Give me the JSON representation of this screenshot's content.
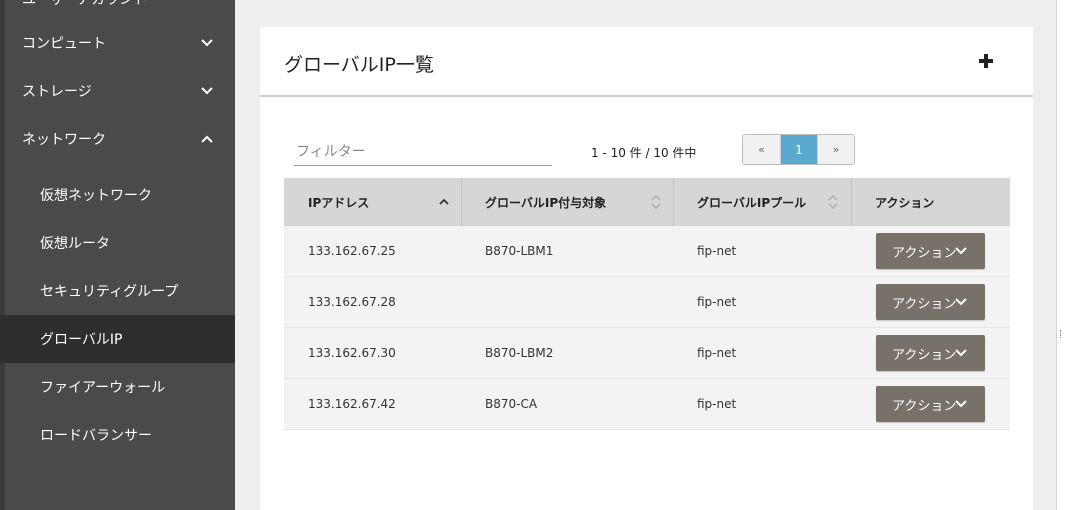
{
  "sidebar": {
    "top_partial": "ユーザーアカウント",
    "sections": [
      {
        "label": "コンピュート",
        "expanded": false
      },
      {
        "label": "ストレージ",
        "expanded": false
      },
      {
        "label": "ネットワーク",
        "expanded": true
      }
    ],
    "sub_items": [
      {
        "label": "仮想ネットワーク",
        "active": false
      },
      {
        "label": "仮想ルータ",
        "active": false
      },
      {
        "label": "セキュリティグループ",
        "active": false
      },
      {
        "label": "グローバルIP",
        "active": true
      },
      {
        "label": "ファイアーウォール",
        "active": false
      },
      {
        "label": "ロードバランサー",
        "active": false
      }
    ]
  },
  "main": {
    "title": "グローバルIP一覧",
    "add_icon": "plus-icon",
    "filter_placeholder": "フィルター",
    "count_text": "1 - 10 件 / 10 件中",
    "pagination": {
      "prev": "«",
      "current": "1",
      "next": "»"
    },
    "table": {
      "headers": [
        "IPアドレス",
        "グローバルIP付与対象",
        "グローバルIPプール",
        "アクション"
      ],
      "rows": [
        {
          "ip": "133.162.67.25",
          "target": "B870-LBM1",
          "pool": "fip-net",
          "action": "アクション"
        },
        {
          "ip": "133.162.67.28",
          "target": "",
          "pool": "fip-net",
          "action": "アクション"
        },
        {
          "ip": "133.162.67.30",
          "target": "B870-LBM2",
          "pool": "fip-net",
          "action": "アクション"
        },
        {
          "ip": "133.162.67.42",
          "target": "B870-CA",
          "pool": "fip-net",
          "action": "アクション"
        }
      ]
    }
  },
  "colors": {
    "sidebar_bg": "#4a4a4a",
    "sidebar_active": "#2e2e2e",
    "page_bg": "#efeeec",
    "accent": "#5aa9cf",
    "action_button": "#777169",
    "table_header": "#d6d6d6"
  }
}
